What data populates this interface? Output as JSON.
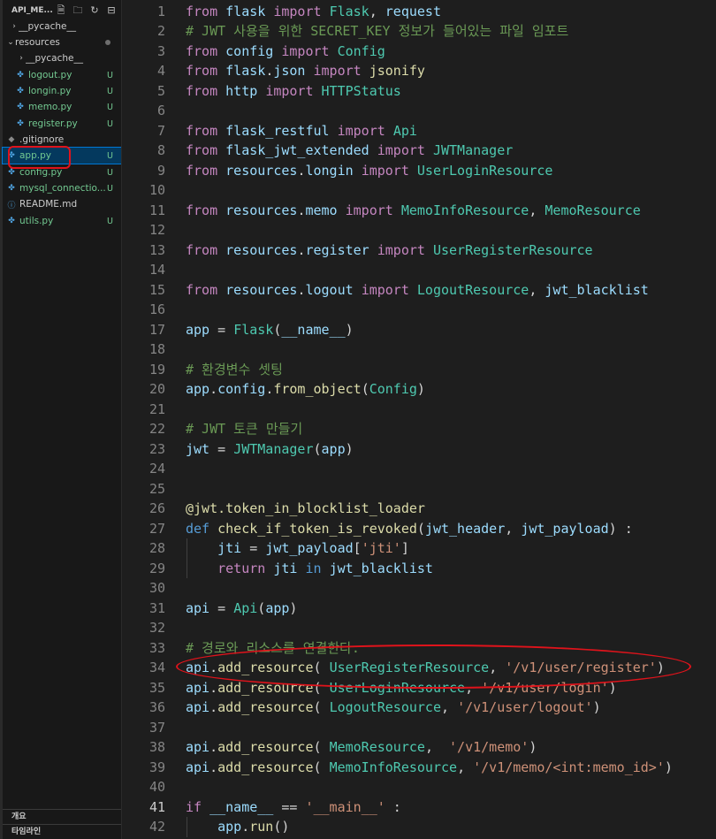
{
  "explorer": {
    "title": "API_ME...",
    "actions": [
      "new-file-icon",
      "new-folder-icon",
      "refresh-icon",
      "collapse-icon"
    ],
    "items": [
      {
        "name": "__pycache__",
        "kind": "folder-collapsed",
        "badge": ""
      },
      {
        "name": "resources",
        "kind": "folder-expanded",
        "badge": "",
        "modified_dot": true
      },
      {
        "name": "__pycache__",
        "kind": "folder-collapsed-nested",
        "badge": ""
      },
      {
        "name": "logout.py",
        "kind": "py-nested",
        "badge": "U"
      },
      {
        "name": "longin.py",
        "kind": "py-nested",
        "badge": "U"
      },
      {
        "name": "memo.py",
        "kind": "py-nested",
        "badge": "U"
      },
      {
        "name": "register.py",
        "kind": "py-nested",
        "badge": "U"
      },
      {
        "name": ".gitignore",
        "kind": "git",
        "badge": ""
      },
      {
        "name": "app.py",
        "kind": "py",
        "badge": "U",
        "selected": true
      },
      {
        "name": "config.py",
        "kind": "py",
        "badge": "U"
      },
      {
        "name": "mysql_connectio...",
        "kind": "py",
        "badge": "U"
      },
      {
        "name": "README.md",
        "kind": "info",
        "badge": ""
      },
      {
        "name": "utils.py",
        "kind": "py",
        "badge": "U"
      }
    ],
    "outline_label": "개요",
    "timeline_label": "타임라인"
  },
  "editor": {
    "active_line": 41,
    "lines": [
      {
        "n": "1",
        "tokens": [
          [
            "imp",
            "from"
          ],
          [
            "plain",
            " "
          ],
          [
            "ident",
            "flask"
          ],
          [
            "plain",
            " "
          ],
          [
            "imp",
            "import"
          ],
          [
            "plain",
            " "
          ],
          [
            "cls",
            "Flask"
          ],
          [
            "plain",
            ", "
          ],
          [
            "ident",
            "request"
          ]
        ]
      },
      {
        "n": "2",
        "tokens": [
          [
            "com",
            "# JWT 사용을 위한 SECRET_KEY 정보가 들어있는 파일 임포트"
          ]
        ]
      },
      {
        "n": "3",
        "tokens": [
          [
            "imp",
            "from"
          ],
          [
            "plain",
            " "
          ],
          [
            "ident",
            "config"
          ],
          [
            "plain",
            " "
          ],
          [
            "imp",
            "import"
          ],
          [
            "plain",
            " "
          ],
          [
            "cls",
            "Config"
          ]
        ]
      },
      {
        "n": "4",
        "tokens": [
          [
            "imp",
            "from"
          ],
          [
            "plain",
            " "
          ],
          [
            "ident",
            "flask"
          ],
          [
            "plain",
            "."
          ],
          [
            "ident",
            "json"
          ],
          [
            "plain",
            " "
          ],
          [
            "imp",
            "import"
          ],
          [
            "plain",
            " "
          ],
          [
            "fn",
            "jsonify"
          ]
        ]
      },
      {
        "n": "5",
        "tokens": [
          [
            "imp",
            "from"
          ],
          [
            "plain",
            " "
          ],
          [
            "ident",
            "http"
          ],
          [
            "plain",
            " "
          ],
          [
            "imp",
            "import"
          ],
          [
            "plain",
            " "
          ],
          [
            "cls",
            "HTTPStatus"
          ]
        ]
      },
      {
        "n": "6",
        "tokens": []
      },
      {
        "n": "7",
        "tokens": [
          [
            "imp",
            "from"
          ],
          [
            "plain",
            " "
          ],
          [
            "ident",
            "flask_restful"
          ],
          [
            "plain",
            " "
          ],
          [
            "imp",
            "import"
          ],
          [
            "plain",
            " "
          ],
          [
            "cls",
            "Api"
          ]
        ]
      },
      {
        "n": "8",
        "tokens": [
          [
            "imp",
            "from"
          ],
          [
            "plain",
            " "
          ],
          [
            "ident",
            "flask_jwt_extended"
          ],
          [
            "plain",
            " "
          ],
          [
            "imp",
            "import"
          ],
          [
            "plain",
            " "
          ],
          [
            "cls",
            "JWTManager"
          ]
        ]
      },
      {
        "n": "9",
        "tokens": [
          [
            "imp",
            "from"
          ],
          [
            "plain",
            " "
          ],
          [
            "ident",
            "resources"
          ],
          [
            "plain",
            "."
          ],
          [
            "ident",
            "longin"
          ],
          [
            "plain",
            " "
          ],
          [
            "imp",
            "import"
          ],
          [
            "plain",
            " "
          ],
          [
            "cls",
            "UserLoginResource"
          ]
        ]
      },
      {
        "n": "10",
        "tokens": []
      },
      {
        "n": "11",
        "tokens": [
          [
            "imp",
            "from"
          ],
          [
            "plain",
            " "
          ],
          [
            "ident",
            "resources"
          ],
          [
            "plain",
            "."
          ],
          [
            "ident",
            "memo"
          ],
          [
            "plain",
            " "
          ],
          [
            "imp",
            "import"
          ],
          [
            "plain",
            " "
          ],
          [
            "cls",
            "MemoInfoResource"
          ],
          [
            "plain",
            ", "
          ],
          [
            "cls",
            "MemoResource"
          ]
        ]
      },
      {
        "n": "12",
        "tokens": []
      },
      {
        "n": "13",
        "tokens": [
          [
            "imp",
            "from"
          ],
          [
            "plain",
            " "
          ],
          [
            "ident",
            "resources"
          ],
          [
            "plain",
            "."
          ],
          [
            "ident",
            "register"
          ],
          [
            "plain",
            " "
          ],
          [
            "imp",
            "import"
          ],
          [
            "plain",
            " "
          ],
          [
            "cls",
            "UserRegisterResource"
          ]
        ]
      },
      {
        "n": "14",
        "tokens": []
      },
      {
        "n": "15",
        "tokens": [
          [
            "imp",
            "from"
          ],
          [
            "plain",
            " "
          ],
          [
            "ident",
            "resources"
          ],
          [
            "plain",
            "."
          ],
          [
            "ident",
            "logout"
          ],
          [
            "plain",
            " "
          ],
          [
            "imp",
            "import"
          ],
          [
            "plain",
            " "
          ],
          [
            "cls",
            "LogoutResource"
          ],
          [
            "plain",
            ", "
          ],
          [
            "ident",
            "jwt_blacklist"
          ]
        ]
      },
      {
        "n": "16",
        "tokens": []
      },
      {
        "n": "17",
        "tokens": [
          [
            "ident",
            "app"
          ],
          [
            "plain",
            " = "
          ],
          [
            "cls",
            "Flask"
          ],
          [
            "plain",
            "("
          ],
          [
            "ident",
            "__name__"
          ],
          [
            "plain",
            ")"
          ]
        ]
      },
      {
        "n": "18",
        "tokens": []
      },
      {
        "n": "19",
        "tokens": [
          [
            "com",
            "# 환경변수 셋팅"
          ]
        ]
      },
      {
        "n": "20",
        "tokens": [
          [
            "ident",
            "app"
          ],
          [
            "plain",
            "."
          ],
          [
            "ident",
            "config"
          ],
          [
            "plain",
            "."
          ],
          [
            "fn",
            "from_object"
          ],
          [
            "plain",
            "("
          ],
          [
            "cls",
            "Config"
          ],
          [
            "plain",
            ")"
          ]
        ]
      },
      {
        "n": "21",
        "tokens": []
      },
      {
        "n": "22",
        "tokens": [
          [
            "com",
            "# JWT 토큰 만들기"
          ]
        ]
      },
      {
        "n": "23",
        "tokens": [
          [
            "ident",
            "jwt"
          ],
          [
            "plain",
            " = "
          ],
          [
            "cls",
            "JWTManager"
          ],
          [
            "plain",
            "("
          ],
          [
            "ident",
            "app"
          ],
          [
            "plain",
            ")"
          ]
        ]
      },
      {
        "n": "24",
        "tokens": []
      },
      {
        "n": "25",
        "tokens": []
      },
      {
        "n": "26",
        "tokens": [
          [
            "fn",
            "@jwt.token_in_blocklist_loader"
          ]
        ]
      },
      {
        "n": "27",
        "tokens": [
          [
            "kw",
            "def"
          ],
          [
            "plain",
            " "
          ],
          [
            "fn",
            "check_if_token_is_revoked"
          ],
          [
            "plain",
            "("
          ],
          [
            "param",
            "jwt_header"
          ],
          [
            "plain",
            ", "
          ],
          [
            "param",
            "jwt_payload"
          ],
          [
            "plain",
            ") :"
          ]
        ]
      },
      {
        "n": "28",
        "tokens": [
          [
            "plain",
            "    "
          ],
          [
            "ident",
            "jti"
          ],
          [
            "plain",
            " = "
          ],
          [
            "ident",
            "jwt_payload"
          ],
          [
            "plain",
            "["
          ],
          [
            "str",
            "'jti'"
          ],
          [
            "plain",
            "]"
          ]
        ]
      },
      {
        "n": "29",
        "tokens": [
          [
            "plain",
            "    "
          ],
          [
            "imp",
            "return"
          ],
          [
            "plain",
            " "
          ],
          [
            "ident",
            "jti"
          ],
          [
            "plain",
            " "
          ],
          [
            "kw",
            "in"
          ],
          [
            "plain",
            " "
          ],
          [
            "ident",
            "jwt_blacklist"
          ]
        ]
      },
      {
        "n": "30",
        "tokens": []
      },
      {
        "n": "31",
        "tokens": [
          [
            "ident",
            "api"
          ],
          [
            "plain",
            " = "
          ],
          [
            "cls",
            "Api"
          ],
          [
            "plain",
            "("
          ],
          [
            "ident",
            "app"
          ],
          [
            "plain",
            ")"
          ]
        ]
      },
      {
        "n": "32",
        "tokens": []
      },
      {
        "n": "33",
        "tokens": [
          [
            "com",
            "# 경로와 리소스를 연결한다."
          ]
        ]
      },
      {
        "n": "34",
        "tokens": [
          [
            "ident",
            "api"
          ],
          [
            "plain",
            "."
          ],
          [
            "fn",
            "add_resource"
          ],
          [
            "plain",
            "( "
          ],
          [
            "cls",
            "UserRegisterResource"
          ],
          [
            "plain",
            ", "
          ],
          [
            "str",
            "'/v1/user/register'"
          ],
          [
            "plain",
            ")"
          ]
        ]
      },
      {
        "n": "35",
        "tokens": [
          [
            "ident",
            "api"
          ],
          [
            "plain",
            "."
          ],
          [
            "fn",
            "add_resource"
          ],
          [
            "plain",
            "( "
          ],
          [
            "cls",
            "UserLoginResource"
          ],
          [
            "plain",
            ", "
          ],
          [
            "str",
            "'/v1/user/login'"
          ],
          [
            "plain",
            ")"
          ]
        ]
      },
      {
        "n": "36",
        "tokens": [
          [
            "ident",
            "api"
          ],
          [
            "plain",
            "."
          ],
          [
            "fn",
            "add_resource"
          ],
          [
            "plain",
            "( "
          ],
          [
            "cls",
            "LogoutResource"
          ],
          [
            "plain",
            ", "
          ],
          [
            "str",
            "'/v1/user/logout'"
          ],
          [
            "plain",
            ")"
          ]
        ]
      },
      {
        "n": "37",
        "tokens": []
      },
      {
        "n": "38",
        "tokens": [
          [
            "ident",
            "api"
          ],
          [
            "plain",
            "."
          ],
          [
            "fn",
            "add_resource"
          ],
          [
            "plain",
            "( "
          ],
          [
            "cls",
            "MemoResource"
          ],
          [
            "plain",
            ",  "
          ],
          [
            "str",
            "'/v1/memo'"
          ],
          [
            "plain",
            ")"
          ]
        ]
      },
      {
        "n": "39",
        "tokens": [
          [
            "ident",
            "api"
          ],
          [
            "plain",
            "."
          ],
          [
            "fn",
            "add_resource"
          ],
          [
            "plain",
            "( "
          ],
          [
            "cls",
            "MemoInfoResource"
          ],
          [
            "plain",
            ", "
          ],
          [
            "str",
            "'/v1/memo/<int:memo_id>'"
          ],
          [
            "plain",
            ")"
          ]
        ]
      },
      {
        "n": "40",
        "tokens": []
      },
      {
        "n": "41",
        "tokens": [
          [
            "imp",
            "if"
          ],
          [
            "plain",
            " "
          ],
          [
            "ident",
            "__name__"
          ],
          [
            "plain",
            " == "
          ],
          [
            "str",
            "'__main__'"
          ],
          [
            "plain",
            " :"
          ]
        ]
      },
      {
        "n": "42",
        "tokens": [
          [
            "plain",
            "    "
          ],
          [
            "ident",
            "app"
          ],
          [
            "plain",
            "."
          ],
          [
            "fn",
            "run"
          ],
          [
            "plain",
            "()"
          ]
        ]
      }
    ]
  },
  "colors": {
    "annotation_red": "#e0131b",
    "untracked_green": "#73c991",
    "selection_blue": "#04395e"
  }
}
